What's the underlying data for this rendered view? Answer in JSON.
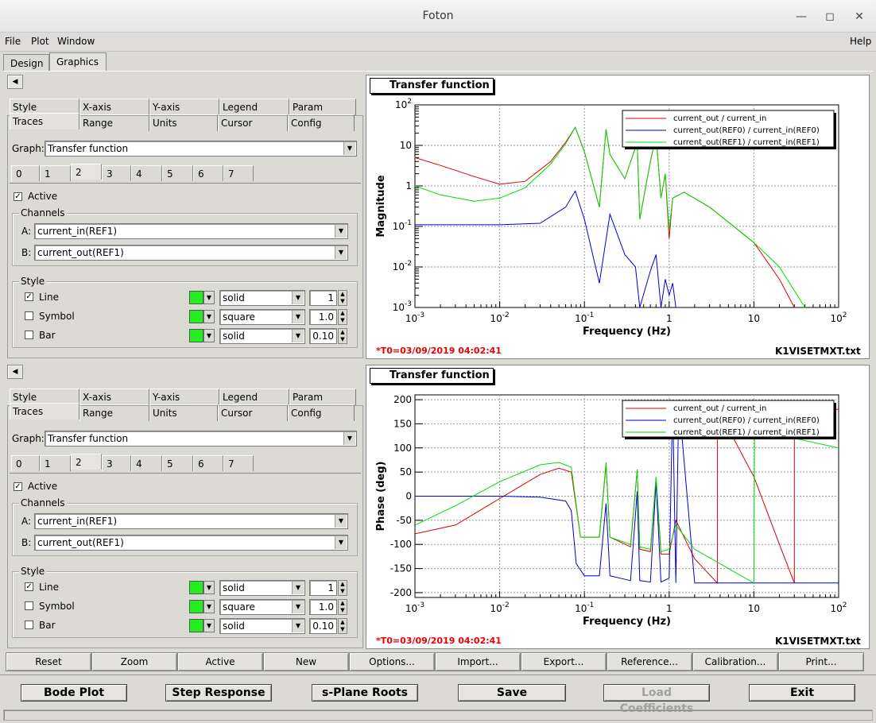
{
  "window": {
    "title": "Foton"
  },
  "menu": {
    "file": "File",
    "plot": "Plot",
    "window": "Window",
    "help": "Help"
  },
  "main_tabs": [
    "Design",
    "Graphics"
  ],
  "options_tabs_row1": [
    "Style",
    "X-axis",
    "Y-axis",
    "Legend",
    "Param"
  ],
  "options_tabs_row2": [
    "Traces",
    "Range",
    "Units",
    "Cursor",
    "Config"
  ],
  "trace_tabs": [
    "0",
    "1",
    "2",
    "3",
    "4",
    "5",
    "6",
    "7"
  ],
  "panels": [
    {
      "graph_label": "Graph:",
      "graph_value": "Transfer function",
      "active_label": "Active",
      "channels_label": "Channels",
      "a_label": "A:",
      "a_value": "current_in(REF1)",
      "b_label": "B:",
      "b_value": "current_out(REF1)",
      "style_label": "Style",
      "line_label": "Line",
      "line_style": "solid",
      "line_width": "1",
      "symbol_label": "Symbol",
      "symbol_style": "square",
      "symbol_size": "1.0",
      "bar_label": "Bar",
      "bar_style": "solid",
      "bar_width": "0.10"
    },
    {
      "graph_label": "Graph:",
      "graph_value": "Transfer function",
      "active_label": "Active",
      "channels_label": "Channels",
      "a_label": "A:",
      "a_value": "current_in(REF1)",
      "b_label": "B:",
      "b_value": "current_out(REF1)",
      "style_label": "Style",
      "line_label": "Line",
      "line_style": "solid",
      "line_width": "1",
      "symbol_label": "Symbol",
      "symbol_style": "square",
      "symbol_size": "1.0",
      "bar_label": "Bar",
      "bar_style": "solid",
      "bar_width": "0.10"
    }
  ],
  "plots": [
    {
      "title": "Transfer function",
      "ylabel": "Magnitude",
      "xlabel": "Frequency (Hz)",
      "timestamp": "*T0=03/09/2019 04:02:41",
      "filename": "K1VISETMXT.txt",
      "legend": [
        "current_out / current_in",
        "current_out(REF0) / current_in(REF0)",
        "current_out(REF1) / current_in(REF1)"
      ]
    },
    {
      "title": "Transfer function",
      "ylabel": "Phase (deg)",
      "xlabel": "Frequency (Hz)",
      "timestamp": "*T0=03/09/2019 04:02:41",
      "filename": "K1VISETMXT.txt",
      "legend": [
        "current_out / current_in",
        "current_out(REF0) / current_in(REF0)",
        "current_out(REF1) / current_in(REF1)"
      ]
    }
  ],
  "toolbar_buttons": [
    "Reset",
    "Zoom",
    "Active",
    "New",
    "Options...",
    "Import...",
    "Export...",
    "Reference...",
    "Calibration...",
    "Print..."
  ],
  "bottom_buttons": [
    {
      "label": "Bode Plot",
      "enabled": true
    },
    {
      "label": "Step Response",
      "enabled": true
    },
    {
      "label": "s-Plane Roots",
      "enabled": true
    },
    {
      "label": "Save",
      "enabled": true
    },
    {
      "label": "Load Coefficients",
      "enabled": false
    },
    {
      "label": "Exit",
      "enabled": true
    }
  ],
  "colors": {
    "series0": "#dd0000",
    "series1": "#0000cc",
    "series2": "#00dd00",
    "swatch": "#22ee22",
    "timestamp": "#ee0000"
  },
  "chart_data": [
    {
      "type": "line",
      "title": "Transfer function",
      "xlabel": "Frequency (Hz)",
      "ylabel": "Magnitude",
      "xscale": "log",
      "yscale": "log",
      "xlim": [
        0.001,
        100
      ],
      "ylim": [
        0.001,
        100
      ],
      "grid": true,
      "legend_position": "top-right",
      "xticks": [
        "10^-3",
        "10^-2",
        "10^-1",
        "1",
        "10",
        "10^2"
      ],
      "yticks": [
        "10^-3",
        "10^-2",
        "10^-1",
        "1",
        "10",
        "10^2"
      ],
      "series": [
        {
          "name": "current_out / current_in",
          "color": "#dd0000",
          "x": [
            0.001,
            0.002,
            0.005,
            0.01,
            0.02,
            0.04,
            0.06,
            0.078,
            0.1,
            0.15,
            0.18,
            0.2,
            0.3,
            0.42,
            0.45,
            0.6,
            0.7,
            0.8,
            0.9,
            1.0,
            1.1,
            1.5,
            3,
            10,
            20,
            30
          ],
          "y": [
            5,
            3.2,
            1.7,
            1.1,
            1.3,
            4,
            12,
            28,
            7,
            0.3,
            25,
            6,
            1.5,
            12,
            0.15,
            4,
            18,
            0.5,
            2,
            0.05,
            0.5,
            0.7,
            0.3,
            0.04,
            0.005,
            0.001
          ]
        },
        {
          "name": "current_out(REF0) / current_in(REF0)",
          "color": "#0000cc",
          "x": [
            0.001,
            0.01,
            0.03,
            0.06,
            0.078,
            0.1,
            0.15,
            0.2,
            0.3,
            0.4,
            0.45,
            0.6,
            0.7,
            0.8,
            0.9,
            1.0,
            1.1,
            1.2
          ],
          "y": [
            0.11,
            0.11,
            0.12,
            0.3,
            0.75,
            0.15,
            0.004,
            0.2,
            0.02,
            0.01,
            0.001,
            0.008,
            0.02,
            0.001,
            0.005,
            0.002,
            0.004,
            0.001
          ]
        },
        {
          "name": "current_out(REF1) / current_in(REF1)",
          "color": "#00dd00",
          "x": [
            0.001,
            0.002,
            0.005,
            0.01,
            0.02,
            0.04,
            0.06,
            0.078,
            0.1,
            0.15,
            0.18,
            0.2,
            0.3,
            0.42,
            0.45,
            0.6,
            0.7,
            0.8,
            0.9,
            1.0,
            1.1,
            1.5,
            3,
            10,
            20,
            40
          ],
          "y": [
            1,
            0.6,
            0.42,
            0.5,
            0.9,
            3.5,
            11,
            28,
            7,
            0.3,
            25,
            6,
            1.5,
            12,
            0.15,
            4,
            18,
            0.5,
            2,
            0.08,
            0.5,
            0.7,
            0.3,
            0.04,
            0.01,
            0.001
          ]
        }
      ]
    },
    {
      "type": "line",
      "title": "Transfer function",
      "xlabel": "Frequency (Hz)",
      "ylabel": "Phase (deg)",
      "xscale": "log",
      "xlim": [
        0.001,
        100
      ],
      "ylim": [
        -210,
        210
      ],
      "grid": true,
      "legend_position": "top-right",
      "xticks": [
        "10^-3",
        "10^-2",
        "10^-1",
        "1",
        "10",
        "10^2"
      ],
      "yticks": [
        "-200",
        "-150",
        "-100",
        "-50",
        "0",
        "50",
        "100",
        "150",
        "200"
      ],
      "series": [
        {
          "name": "current_out / current_in",
          "color": "#dd0000",
          "x": [
            0.001,
            0.003,
            0.01,
            0.03,
            0.05,
            0.07,
            0.09,
            0.15,
            0.18,
            0.2,
            0.35,
            0.42,
            0.45,
            0.6,
            0.7,
            0.8,
            1.0,
            1.2,
            2,
            3.7,
            3.7,
            5,
            10,
            20,
            30,
            30,
            100
          ],
          "y": [
            -78,
            -60,
            -5,
            45,
            58,
            50,
            -85,
            -85,
            65,
            -85,
            -105,
            55,
            -110,
            -115,
            38,
            -120,
            -120,
            -50,
            -130,
            -180,
            180,
            140,
            40,
            -100,
            -180,
            180,
            180
          ]
        },
        {
          "name": "current_out(REF0) / current_in(REF0)",
          "color": "#0000cc",
          "x": [
            0.001,
            0.01,
            0.03,
            0.06,
            0.07,
            0.08,
            0.1,
            0.15,
            0.18,
            0.2,
            0.35,
            0.42,
            0.45,
            0.6,
            0.7,
            0.8,
            1.0,
            1.1,
            1.2,
            1.3,
            2,
            10,
            100
          ],
          "y": [
            0,
            0,
            -2,
            -10,
            -30,
            -140,
            -165,
            -165,
            -15,
            -165,
            -175,
            10,
            -175,
            -178,
            30,
            -178,
            -170,
            200,
            -180,
            200,
            -180,
            -180,
            -180
          ]
        },
        {
          "name": "current_out(REF1) / current_in(REF1)",
          "color": "#00dd00",
          "x": [
            0.001,
            0.003,
            0.01,
            0.03,
            0.05,
            0.07,
            0.09,
            0.15,
            0.18,
            0.2,
            0.35,
            0.42,
            0.45,
            0.6,
            0.7,
            0.8,
            1.0,
            1.2,
            2,
            5,
            10,
            10.2,
            30,
            100
          ],
          "y": [
            -60,
            -20,
            30,
            65,
            70,
            60,
            -85,
            -85,
            70,
            -85,
            -100,
            55,
            -105,
            -110,
            40,
            -115,
            -110,
            -60,
            -110,
            -150,
            -180,
            180,
            120,
            100
          ]
        }
      ]
    }
  ]
}
